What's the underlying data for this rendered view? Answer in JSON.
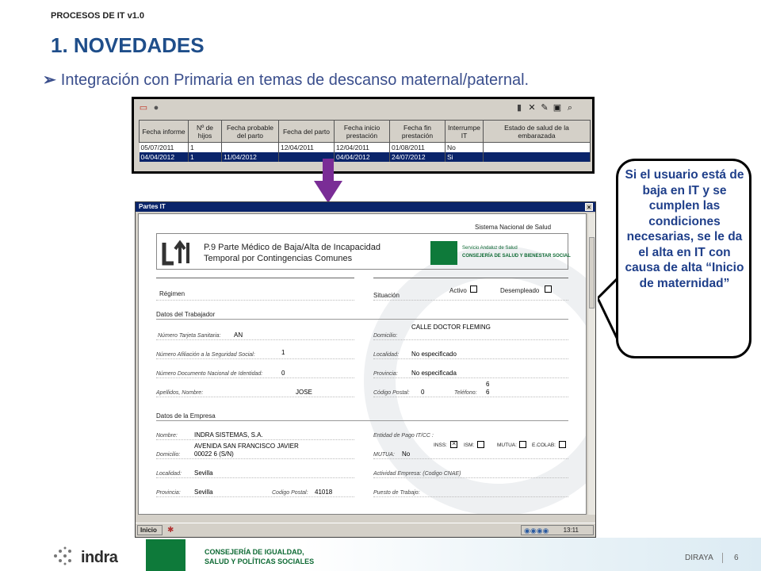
{
  "header": {
    "top_label": "PROCESOS DE IT v1.0",
    "title": "1. NOVEDADES",
    "bullet": "Integración con Primaria en temas de descanso maternal/paternal."
  },
  "grid": {
    "columns": [
      "Fecha informe",
      "Nº de hijos",
      "Fecha probable del parto",
      "Fecha del parto",
      "Fecha inicio prestación",
      "Fecha fin prestación",
      "Interrumpe IT",
      "Estado de salud de la embarazada"
    ],
    "rows": [
      [
        "05/07/2011",
        "1",
        "",
        "12/04/2011",
        "12/04/2011",
        "01/08/2011",
        "No",
        ""
      ],
      [
        "04/04/2012",
        "1",
        "11/04/2012",
        "",
        "04/04/2012",
        "24/07/2012",
        "Si",
        ""
      ]
    ],
    "selected_row": 1
  },
  "window": {
    "title": "Partes IT",
    "close": "×",
    "taskbar": {
      "start": "Inicio",
      "clock": "13:11"
    }
  },
  "form": {
    "system_name": "Sistema Nacional de Salud",
    "doc_title_1": "P.9 Parte Médico de Baja/Alta de Incapacidad",
    "doc_title_2": "Temporal por Contingencias Comunes",
    "logo_line_1": "Servicio Andaluz de Salud",
    "logo_line_2": "CONSEJERÍA DE SALUD Y BIENESTAR SOCIAL",
    "regimen_label": "Régimen",
    "situacion_label": "Situación",
    "activo_label": "Activo",
    "desempleado_label": "Desempleado",
    "trabajador_section": "Datos del Trabajador",
    "tarjeta_label": "Número Tarjeta Sanitaria:",
    "tarjeta_value": "AN",
    "domicilio_label": "Domicilio:",
    "domicilio_value": "CALLE DOCTOR FLEMING",
    "afiliacion_label": "Número Afiliación a la Seguridad Social:",
    "afiliacion_value": "1",
    "localidad_label": "Localidad:",
    "localidad_value": "No especificado",
    "dni_label": "Número Documento Nacional de Identidad:",
    "dni_value": "0",
    "provincia_label": "Provincia:",
    "provincia_value": "No especificada",
    "apellidos_label": "Apellidos, Nombre:",
    "apellidos_value": "JOSE",
    "cp_label": "Código Postal:",
    "cp_value": "0",
    "telefono_label": "Teléfono:",
    "telefono_value_1": "6",
    "telefono_value_2": "6",
    "empresa_section": "Datos de la Empresa",
    "nombre_label": "Nombre:",
    "nombre_value": "INDRA SISTEMAS, S.A.",
    "entidad_label": "Entidad de Pago IT/CC :",
    "inss_label": "INSS:",
    "ism_label": "ISM:",
    "mutua_cb_label": "MUTUA:",
    "ecolab_label": "E.COLAB:",
    "emp_dom_label": "Domicilio:",
    "emp_dom_value_1": "AVENIDA SAN FRANCISCO JAVIER",
    "emp_dom_value_2": "00022   6 (S/N)",
    "mutua_label": "MUTUA:",
    "mutua_value": "No",
    "emp_loc_label": "Localidad:",
    "emp_loc_value": "Sevilla",
    "actividad_label": "Actividad Empresa: (Codigo CNAE)",
    "emp_prov_label": "Provincia:",
    "emp_prov_value": "Sevilla",
    "emp_cp_label": "Codigo Postal:",
    "emp_cp_value": "41018",
    "puesto_label": "Puesto de Trabajo:"
  },
  "callout": {
    "text": "Si el usuario está de baja en IT y se cumplen las condiciones necesarias, se le da el alta en IT con causa de alta “Inicio de maternidad”"
  },
  "footer": {
    "brand": "indra",
    "consejeria_1": "CONSEJERÍA DE IGUALDAD,",
    "consejeria_2": "SALUD Y POLÍTICAS SOCIALES",
    "app": "DIRAYA",
    "page": "6"
  },
  "colors": {
    "title_blue": "#1f4e8a",
    "selection": "#0a246a",
    "arrow_purple": "#7a2d96",
    "junta_green": "#0e7a3a"
  }
}
